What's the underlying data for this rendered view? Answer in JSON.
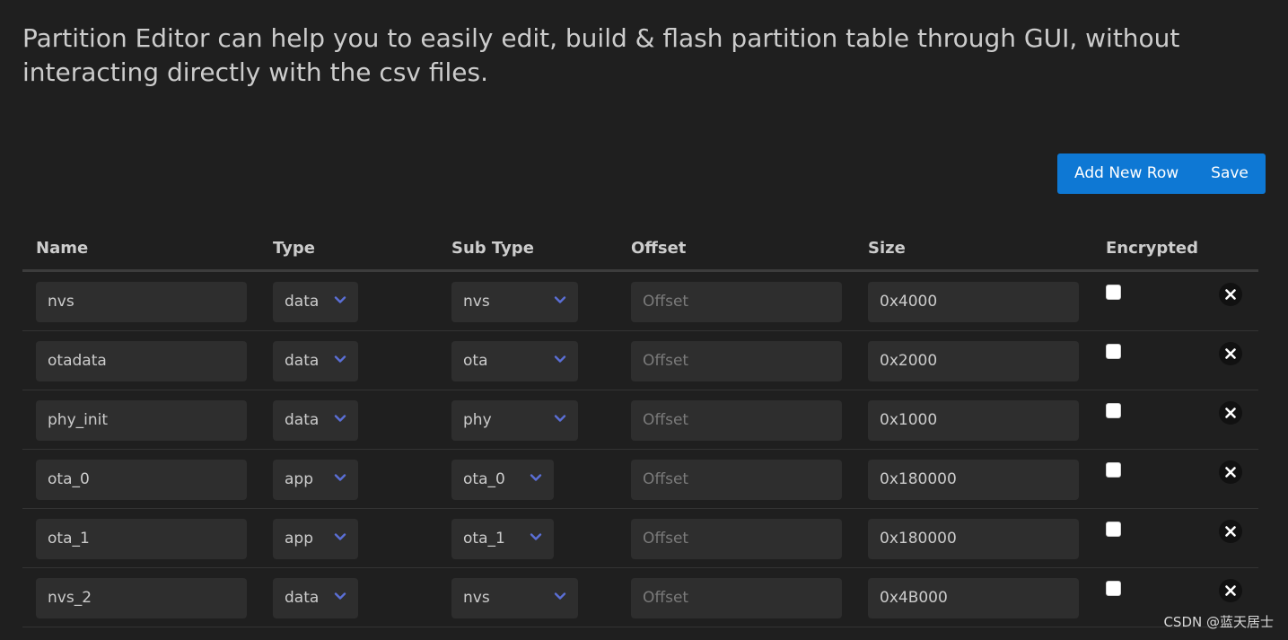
{
  "intro": "Partition Editor can help you to easily edit, build & flash partition table through GUI, without interacting directly with the csv files.",
  "actions": {
    "add_label": "Add New Row",
    "save_label": "Save"
  },
  "columns": {
    "name": "Name",
    "type": "Type",
    "subtype": "Sub Type",
    "offset": "Offset",
    "size": "Size",
    "encrypted": "Encrypted"
  },
  "offset_placeholder": "Offset",
  "rows": [
    {
      "name": "nvs",
      "type": "data",
      "subtype": "nvs",
      "offset": "",
      "size": "0x4000",
      "encrypted": false
    },
    {
      "name": "otadata",
      "type": "data",
      "subtype": "ota",
      "offset": "",
      "size": "0x2000",
      "encrypted": false
    },
    {
      "name": "phy_init",
      "type": "data",
      "subtype": "phy",
      "offset": "",
      "size": "0x1000",
      "encrypted": false
    },
    {
      "name": "ota_0",
      "type": "app",
      "subtype": "ota_0",
      "offset": "",
      "size": "0x180000",
      "encrypted": false
    },
    {
      "name": "ota_1",
      "type": "app",
      "subtype": "ota_1",
      "offset": "",
      "size": "0x180000",
      "encrypted": false
    },
    {
      "name": "nvs_2",
      "type": "data",
      "subtype": "nvs",
      "offset": "",
      "size": "0x4B000",
      "encrypted": false
    }
  ],
  "colors": {
    "accent": "#0e78d4",
    "chevron": "#5b6fd6",
    "background": "#1f1f1f",
    "field": "#2e2e2e"
  },
  "icons": {
    "dropdown": "chevron-down-icon",
    "delete": "close-icon"
  },
  "watermark": "CSDN @蓝天居士"
}
